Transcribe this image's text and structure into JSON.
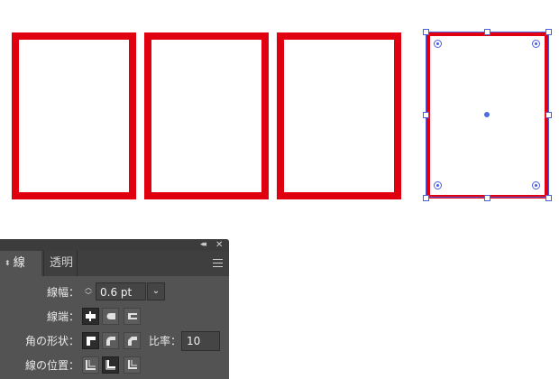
{
  "panel": {
    "tabs": [
      {
        "label": "線",
        "active": true
      },
      {
        "label": "透明",
        "active": false
      }
    ],
    "collapse_icon": "double-left-arrow",
    "close_icon": "close-x",
    "menu_icon": "hamburger-menu"
  },
  "stroke": {
    "weight_label": "線幅：",
    "weight_value": "0.6 pt",
    "cap_label": "線端：",
    "corner_label": "角の形状：",
    "ratio_label": "比率：",
    "ratio_value": "10",
    "align_label": "線の位置："
  },
  "colors": {
    "stroke_red": "#e0000f",
    "selection_blue": "#4a5ee0",
    "panel_bg": "#535353"
  }
}
